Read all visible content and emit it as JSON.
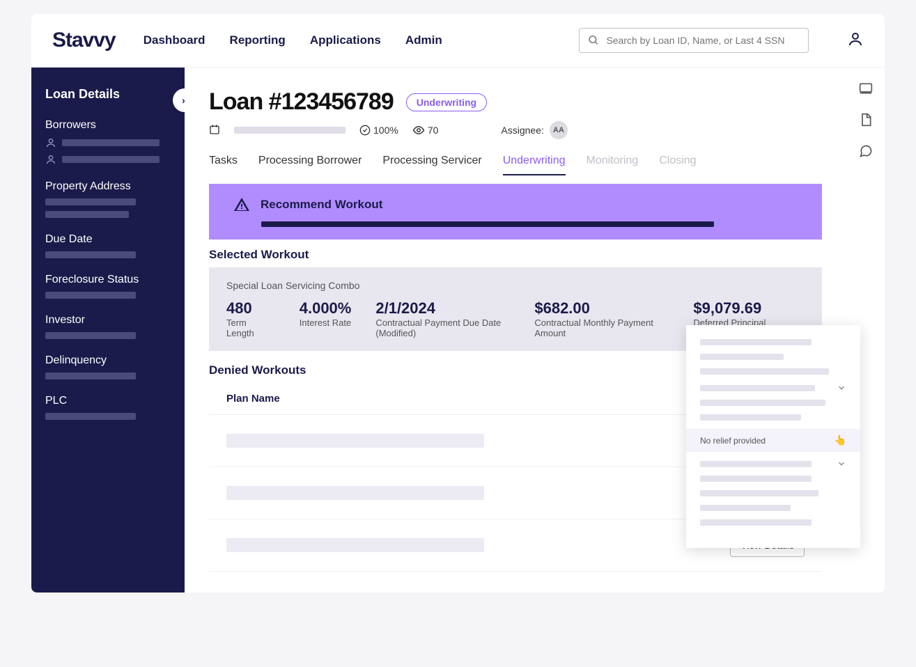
{
  "brand": "Stavvy",
  "nav": [
    "Dashboard",
    "Reporting",
    "Applications",
    "Admin"
  ],
  "search": {
    "placeholder": "Search by Loan ID, Name, or Last 4 SSN"
  },
  "sidebar": {
    "title": "Loan Details",
    "sections": [
      "Borrowers",
      "Property Address",
      "Due Date",
      "Foreclosure Status",
      "Investor",
      "Delinquency",
      "PLC"
    ]
  },
  "loan": {
    "title": "Loan #123456789",
    "status": "Underwriting",
    "completion": "100%",
    "views": "70",
    "assignee_label": "Assignee:",
    "assignee_initials": "AA"
  },
  "tabs": [
    "Tasks",
    "Processing Borrower",
    "Processing Servicer",
    "Underwriting",
    "Monitoring",
    "Closing"
  ],
  "active_tab": 3,
  "disabled_tabs": [
    4,
    5
  ],
  "banner": {
    "title": "Recommend Workout"
  },
  "selected": {
    "heading": "Selected Workout",
    "sub": "Special Loan Servicing Combo",
    "metrics": [
      {
        "val": "480",
        "lbl": "Term Length"
      },
      {
        "val": "4.000%",
        "lbl": "Interest Rate"
      },
      {
        "val": "2/1/2024",
        "lbl": "Contractual Payment Due Date (Modified)"
      },
      {
        "val": "$682.00",
        "lbl": "Contractual Monthly Payment Amount"
      },
      {
        "val": "$9,079.69",
        "lbl": "Deferred Principal (Modified)"
      }
    ]
  },
  "denied": {
    "heading": "Denied Workouts",
    "column": "Plan Name",
    "button": "View Details"
  },
  "popover": {
    "highlight": "No relief provided"
  }
}
